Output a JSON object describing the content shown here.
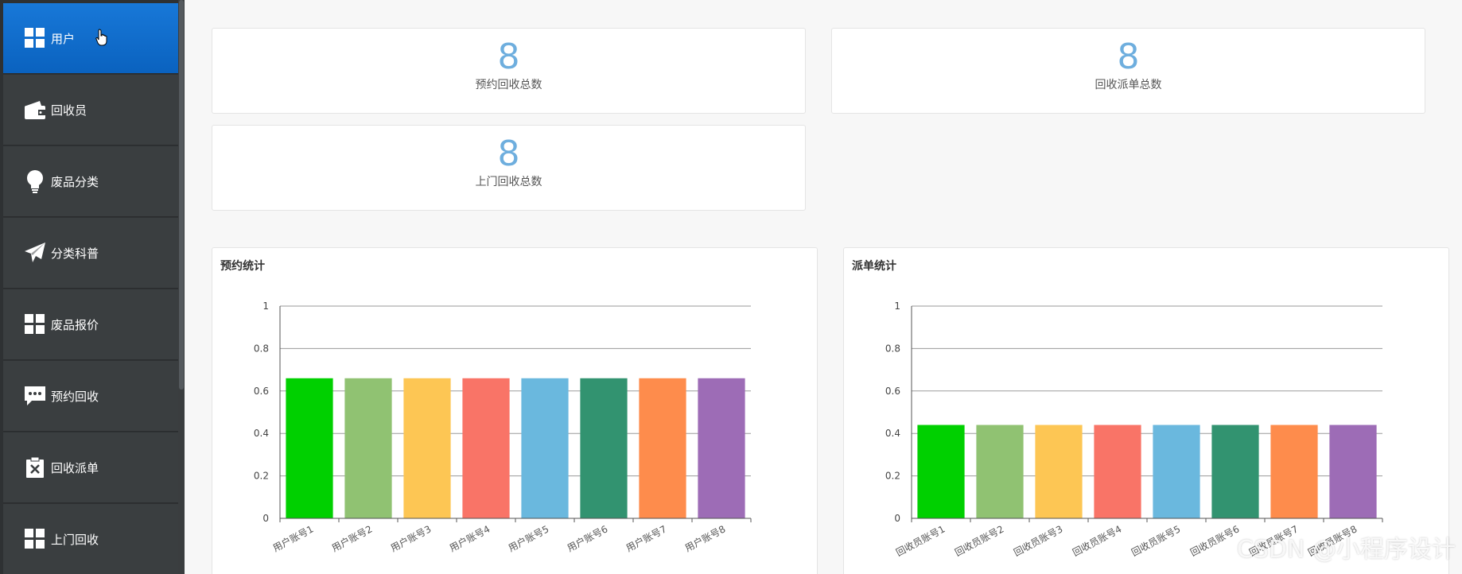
{
  "sidebar": {
    "items": [
      {
        "label": "用户",
        "icon": "grid-icon",
        "active": true
      },
      {
        "label": "回收员",
        "icon": "wallet-icon",
        "active": false
      },
      {
        "label": "废品分类",
        "icon": "lightbulb-icon",
        "active": false
      },
      {
        "label": "分类科普",
        "icon": "paper-plane-icon",
        "active": false
      },
      {
        "label": "废品报价",
        "icon": "grid-icon",
        "active": false
      },
      {
        "label": "预约回收",
        "icon": "chat-bubble-icon",
        "active": false
      },
      {
        "label": "回收派单",
        "icon": "clipboard-x-icon",
        "active": false
      },
      {
        "label": "上门回收",
        "icon": "grid-icon",
        "active": false
      }
    ]
  },
  "stats": [
    {
      "value": "8",
      "label": "预约回收总数"
    },
    {
      "value": "8",
      "label": "回收派单总数"
    },
    {
      "value": "8",
      "label": "上门回收总数"
    }
  ],
  "panels": {
    "left_title": "预约统计",
    "right_title": "派单统计"
  },
  "colors": {
    "active_nav": "#0d6fcf",
    "sidebar_bg": "#3a3e40",
    "stat_number": "#6eaede",
    "bars": [
      "#00d000",
      "#90c272",
      "#fdc654",
      "#f97467",
      "#6ab8de",
      "#329370",
      "#fe8c4c",
      "#9d6cb6"
    ]
  },
  "chart_data": [
    {
      "type": "bar",
      "title": "预约统计",
      "categories": [
        "用户账号1",
        "用户账号2",
        "用户账号3",
        "用户账号4",
        "用户账号5",
        "用户账号6",
        "用户账号7",
        "用户账号8"
      ],
      "values": [
        0.66,
        0.66,
        0.66,
        0.66,
        0.66,
        0.66,
        0.66,
        0.66
      ],
      "ylim": [
        0,
        1
      ],
      "yticks": [
        "0",
        "0.2",
        "0.4",
        "0.6",
        "0.8",
        "1"
      ],
      "grid": true
    },
    {
      "type": "bar",
      "title": "派单统计",
      "categories": [
        "回收员账号1",
        "回收员账号2",
        "回收员账号3",
        "回收员账号4",
        "回收员账号5",
        "回收员账号6",
        "回收员账号7",
        "回收员账号8"
      ],
      "values": [
        0.44,
        0.44,
        0.44,
        0.44,
        0.44,
        0.44,
        0.44,
        0.44
      ],
      "ylim": [
        0,
        1
      ],
      "yticks": [
        "0",
        "0.2",
        "0.4",
        "0.6",
        "0.8",
        "1"
      ],
      "grid": true
    }
  ],
  "watermark": "CSDN @小程序设计"
}
